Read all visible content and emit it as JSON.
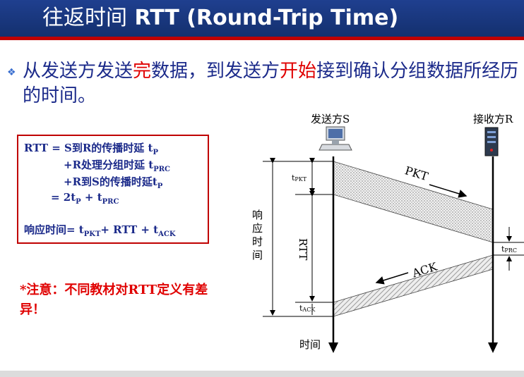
{
  "slide": {
    "title_cn": "往返时间",
    "title_en": "RTT (Round-Trip Time)",
    "bullet_icon": "diamond-bullet-icon",
    "para": {
      "p1": "从发送方发送",
      "hl1": "完",
      "p2": "数据，到发送方",
      "hl2": "开始",
      "p3": "接到确认分组数据所经历的时间。"
    },
    "formula": {
      "l1_a": "RTT =  S到R的传播时延 t",
      "l1_sub": "P",
      "l2_a": "+R处理分组时延 t",
      "l2_sub": "PRC",
      "l3_a": "+R到S的传播时延t",
      "l3_sub": "P",
      "l4_a": "= 2t",
      "l4_sub1": "P",
      "l4_b": " + t",
      "l4_sub2": "PRC",
      "l5_a": "响应时间= t",
      "l5_sub1": "PKT",
      "l5_b": "+ RTT + t",
      "l5_sub2": "ACK"
    },
    "note": "*注意：不同教材对RTT定义有差异！"
  },
  "diagram": {
    "sender_label": "发送方S",
    "receiver_label": "接收方R",
    "sender_icon": "computer-icon",
    "receiver_icon": "server-icon",
    "pkt_label": "PKT",
    "ack_label": "ACK",
    "t_pkt_main": "t",
    "t_pkt_sub": "PKT",
    "t_ack_main": "t",
    "t_ack_sub": "ACK",
    "t_prc_main": "t",
    "t_prc_sub": "PRC",
    "rtt_label": "RTT",
    "response_label": "响应时间",
    "time_label": "时间"
  }
}
